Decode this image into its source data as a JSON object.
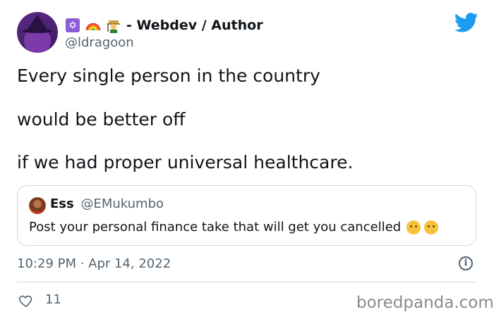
{
  "tweet": {
    "display_name": "- Webdev / Author",
    "handle": "@ldragoon",
    "body_lines": [
      "Every single person in the country",
      "would be better off",
      "if we had proper universal healthcare."
    ],
    "timestamp": "10:29 PM · Apr 14, 2022",
    "likes": "11"
  },
  "quoted": {
    "name": "Ess",
    "handle": "@EMukumbo",
    "text": "Post your personal finance take that will get you cancelled"
  },
  "icons": {
    "name_emojis": [
      "star-of-david-emoji",
      "rainbow-emoji",
      "farmer-emoji"
    ],
    "brand": "twitter-bird-icon",
    "info": "info-icon",
    "like": "heart-icon"
  },
  "colors": {
    "twitter_blue": "#1d9bf0",
    "secondary_text": "#536471",
    "border": "#cfd9de"
  },
  "watermark": "boredpanda.com"
}
